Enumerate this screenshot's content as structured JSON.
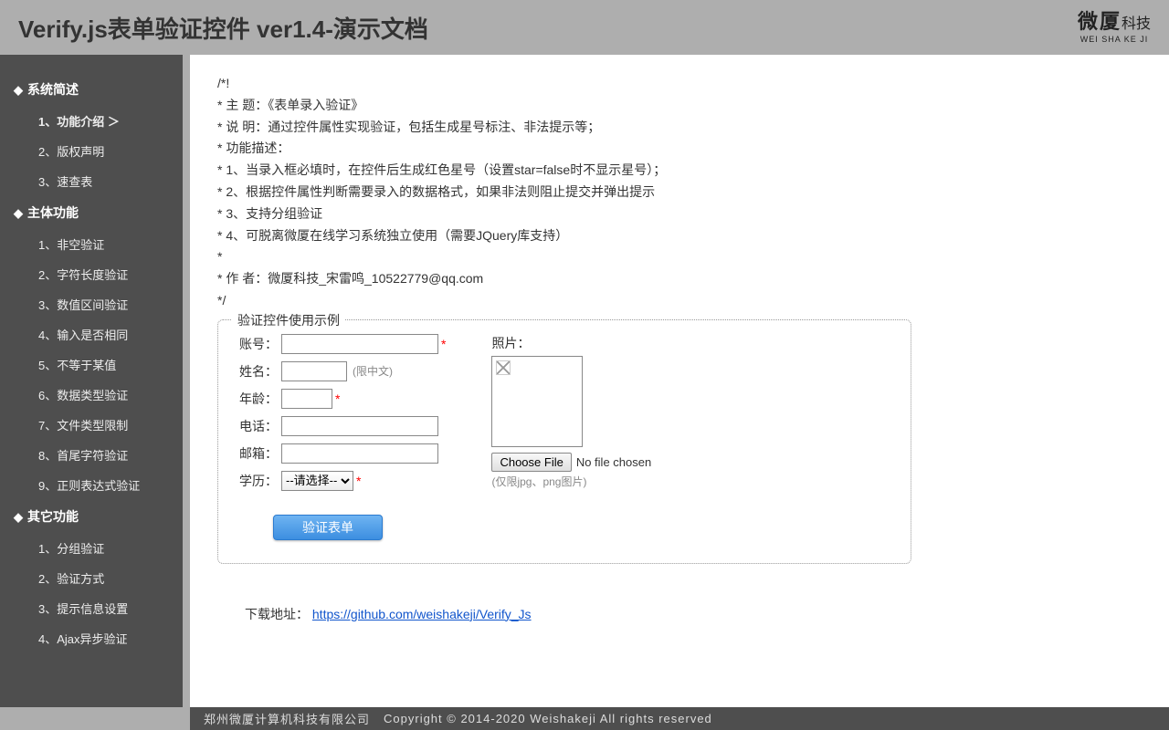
{
  "header": {
    "title": "Verify.js表单验证控件 ver1.4-演示文档",
    "logo_cn": "微厦",
    "logo_side": "科技",
    "logo_en": "WEI SHA KE JI"
  },
  "sidebar": {
    "groups": [
      {
        "title": "系统简述",
        "items": [
          "1、功能介绍 ＞",
          "2、版权声明",
          "3、速查表"
        ]
      },
      {
        "title": "主体功能",
        "items": [
          "1、非空验证",
          "2、字符长度验证",
          "3、数值区间验证",
          "4、输入是否相同",
          "5、不等于某值",
          "6、数据类型验证",
          "7、文件类型限制",
          "8、首尾字符验证",
          "9、正则表达式验证"
        ]
      },
      {
        "title": "其它功能",
        "items": [
          "1、分组验证",
          "2、验证方式",
          "3、提示信息设置",
          "4、Ajax异步验证"
        ]
      }
    ]
  },
  "comment": {
    "l0": "/*!",
    "l1": "* 主 题：《表单录入验证》",
    "l2": "* 说 明：通过控件属性实现验证，包括生成星号标注、非法提示等；",
    "l3": "* 功能描述：",
    "l4": "* 1、当录入框必填时，在控件后生成红色星号（设置star=false时不显示星号）；",
    "l5": "* 2、根据控件属性判断需要录入的数据格式，如果非法则阻止提交并弹出提示",
    "l6": "* 3、支持分组验证",
    "l7": "* 4、可脱离微厦在线学习系统独立使用（需要JQuery库支持）",
    "l8": "*",
    "l9": "* 作 者：微厦科技_宋雷鸣_10522779@qq.com",
    "l10": "*/"
  },
  "form": {
    "legend": "验证控件使用示例",
    "labels": {
      "account": "账号：",
      "name": "姓名：",
      "age": "年龄：",
      "phone": "电话：",
      "email": "邮箱：",
      "edu": "学历：",
      "photo": "照片："
    },
    "name_hint": "(限中文)",
    "edu_option": "--请选择--",
    "choose_file": "Choose File",
    "no_file": "No file chosen",
    "file_hint": "(仅限jpg、png图片)",
    "submit": "验证表单"
  },
  "download": {
    "label": "下载地址：",
    "url": "https://github.com/weishakeji/Verify_Js"
  },
  "footer": {
    "company": "郑州微厦计算机科技有限公司",
    "copyright": "Copyright © 2014-2020 Weishakeji All rights reserved"
  }
}
